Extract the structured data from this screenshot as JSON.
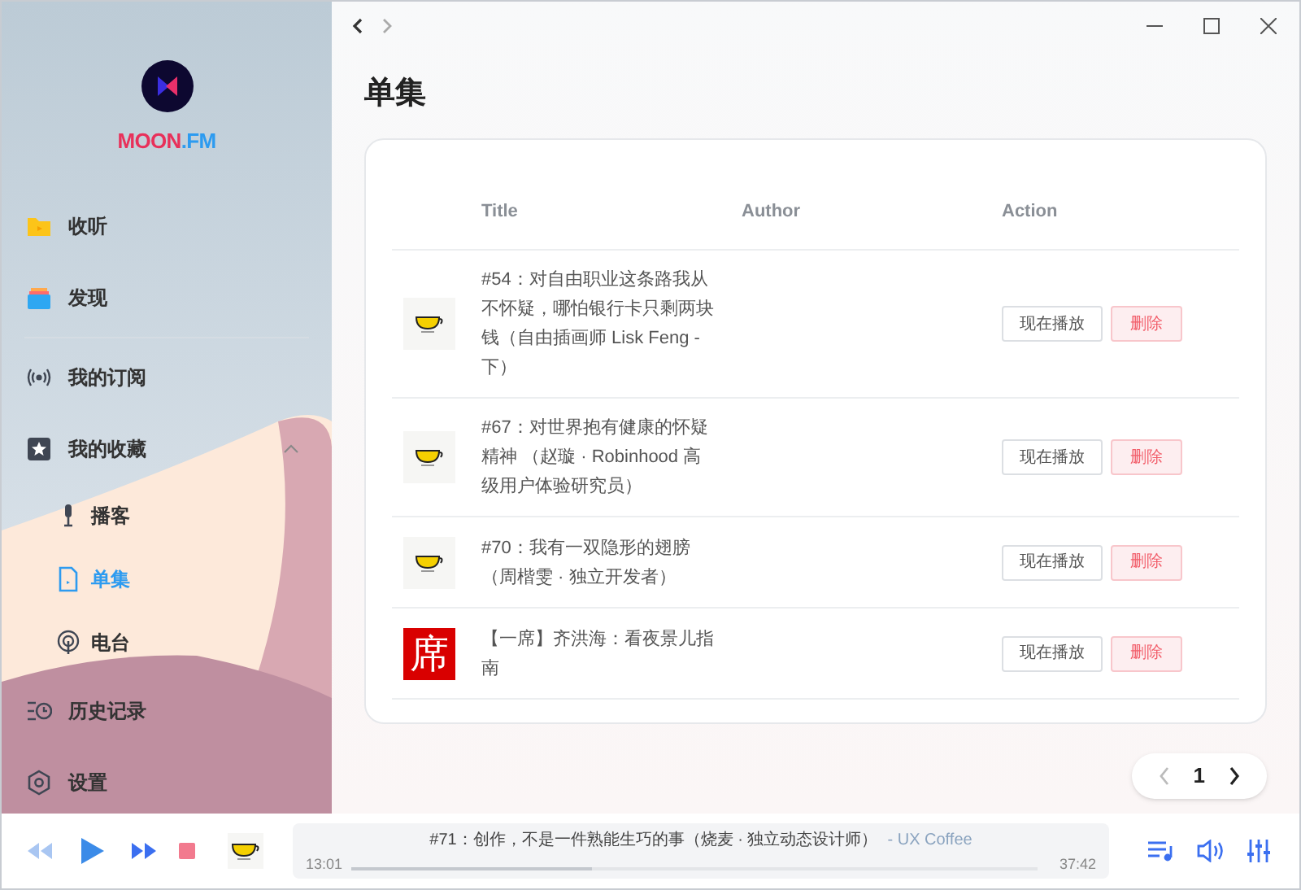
{
  "app": {
    "logo_text_left": "MOON",
    "logo_text_right": ".FM"
  },
  "sidebar": {
    "items": [
      {
        "label": "收听",
        "kind": "folder",
        "selected": false
      },
      {
        "label": "发现",
        "kind": "cards",
        "selected": false
      },
      {
        "label": "我的订阅",
        "kind": "radio",
        "selected": false
      },
      {
        "label": "我的收藏",
        "kind": "star",
        "selected": false,
        "expanded": true,
        "children": [
          {
            "label": "播客",
            "kind": "mic",
            "selected": false
          },
          {
            "label": "单集",
            "kind": "file",
            "selected": true
          },
          {
            "label": "电台",
            "kind": "antenna",
            "selected": false
          }
        ]
      },
      {
        "label": "历史记录",
        "kind": "history",
        "selected": false
      },
      {
        "label": "设置",
        "kind": "gear",
        "selected": false
      }
    ]
  },
  "page": {
    "title": "单集"
  },
  "table": {
    "columns": [
      "Title",
      "Author",
      "Action"
    ],
    "rows": [
      {
        "kind": "cup",
        "title": "#54：对自由职业这条路我从不怀疑，哪怕银行卡只剩两块钱（自由插画师 Lisk Feng - 下）",
        "actions": [
          "现在播放",
          "删除"
        ]
      },
      {
        "kind": "cup",
        "title": "#67：对世界抱有健康的怀疑精神 （赵璇 · Robinhood 高级用户体验研究员）",
        "actions": [
          "现在播放",
          "删除"
        ]
      },
      {
        "kind": "cup",
        "title": "#70：我有一双隐形的翅膀（周楷雯 · 独立开发者）",
        "actions": [
          "现在播放",
          "删除"
        ]
      },
      {
        "kind": "glyph",
        "cover_text": "席",
        "title": "【一席】齐洪海：看夜景儿指南",
        "actions": [
          "现在播放",
          "删除"
        ]
      }
    ]
  },
  "pagination": {
    "page": "1"
  },
  "player": {
    "title": "#71：创作，不是一件熟能生巧的事（烧麦 · 独立动态设计师）",
    "podcast": "- UX Coffee",
    "elapsed": "13:01",
    "duration": "37:42",
    "level": 0.35,
    "kind": "cup"
  }
}
